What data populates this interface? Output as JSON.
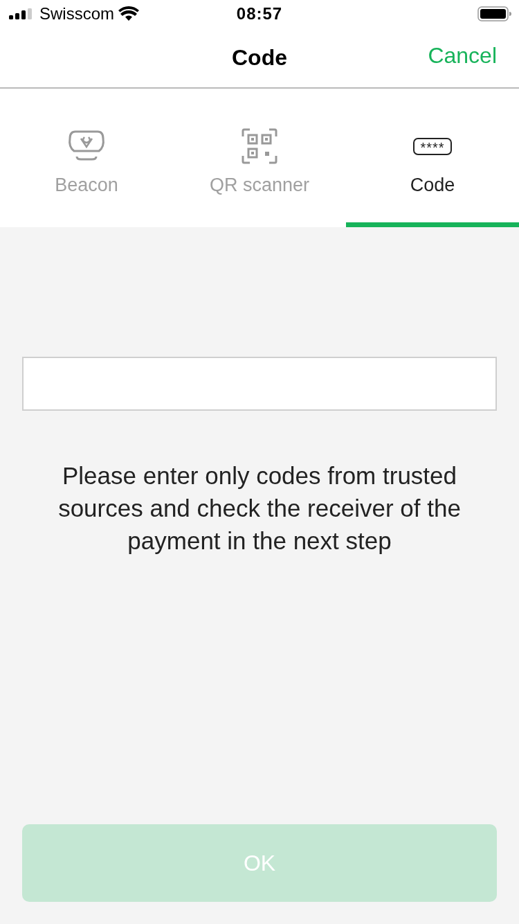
{
  "status_bar": {
    "carrier": "Swisscom",
    "time": "08:57"
  },
  "nav": {
    "title": "Code",
    "action": "Cancel"
  },
  "tabs": [
    {
      "kind": "beacon",
      "label": "Beacon",
      "selected": false
    },
    {
      "kind": "qr",
      "label": "QR scanner",
      "selected": false
    },
    {
      "kind": "code",
      "label": "Code",
      "icon_text": "****",
      "selected": true
    }
  ],
  "notice": "Please enter only codes from trusted sources and check the receiver of the payment in the next step",
  "ok_button": {
    "label": "OK",
    "disabled": true
  }
}
